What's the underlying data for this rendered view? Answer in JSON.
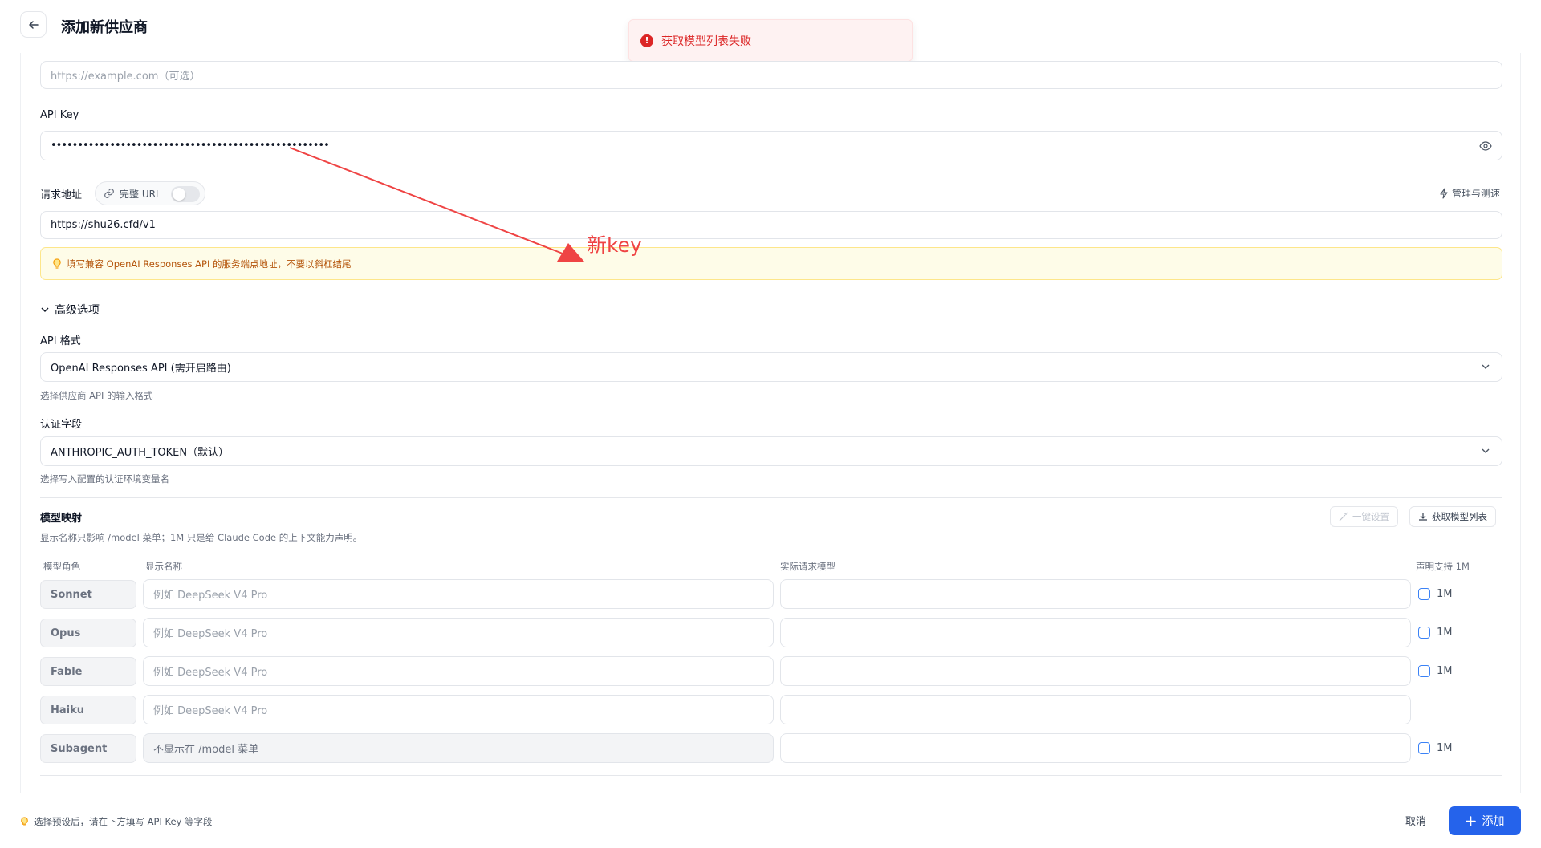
{
  "header": {
    "title": "添加新供应商"
  },
  "toast": {
    "message": "获取模型列表失败"
  },
  "website": {
    "placeholder": "https://example.com（可选）"
  },
  "api_key": {
    "label": "API Key",
    "masked_value": "••••••••••••••••••••••••••••••••••••••••••••••••••••"
  },
  "endpoint": {
    "label": "请求地址",
    "full_url_label": "完整 URL",
    "full_url_enabled": false,
    "manage_label": "管理与测速",
    "value": "https://shu26.cfd/v1",
    "warning": "填写兼容 OpenAI Responses API 的服务端点地址，不要以斜杠结尾"
  },
  "annotation": {
    "text": "新key",
    "color": "#ef4444"
  },
  "advanced": {
    "title": "高级选项",
    "api_format": {
      "label": "API 格式",
      "value": "OpenAI Responses API (需开启路由)",
      "hint": "选择供应商 API 的输入格式"
    },
    "auth_field": {
      "label": "认证字段",
      "value": "ANTHROPIC_AUTH_TOKEN（默认）",
      "hint": "选择写入配置的认证环境变量名"
    }
  },
  "model_mapping": {
    "title": "模型映射",
    "hint": "显示名称只影响 /model 菜单；1M 只是给 Claude Code 的上下文能力声明。",
    "one_click_label": "一键设置",
    "fetch_label": "获取模型列表",
    "columns": {
      "role": "模型角色",
      "display_name": "显示名称",
      "actual_model": "实际请求模型",
      "support_1m": "声明支持 1M"
    },
    "rows": [
      {
        "role": "Sonnet",
        "display_placeholder": "例如 DeepSeek V4 Pro",
        "has_1m": true,
        "label_1m": "1M"
      },
      {
        "role": "Opus",
        "display_placeholder": "例如 DeepSeek V4 Pro",
        "has_1m": true,
        "label_1m": "1M"
      },
      {
        "role": "Fable",
        "display_placeholder": "例如 DeepSeek V4 Pro",
        "has_1m": true,
        "label_1m": "1M"
      },
      {
        "role": "Haiku",
        "display_placeholder": "例如 DeepSeek V4 Pro",
        "has_1m": false,
        "label_1m": ""
      },
      {
        "role": "Subagent",
        "display_placeholder": "不显示在 /model 菜单",
        "has_1m": true,
        "label_1m": "1M"
      }
    ]
  },
  "footer": {
    "hint": "选择预设后，请在下方填写 API Key 等字段",
    "cancel_label": "取消",
    "add_label": "添加"
  },
  "colors": {
    "primary": "#2563eb",
    "error": "#dc2626",
    "warning_bg": "#fefce8",
    "warning_text": "#b45309"
  }
}
